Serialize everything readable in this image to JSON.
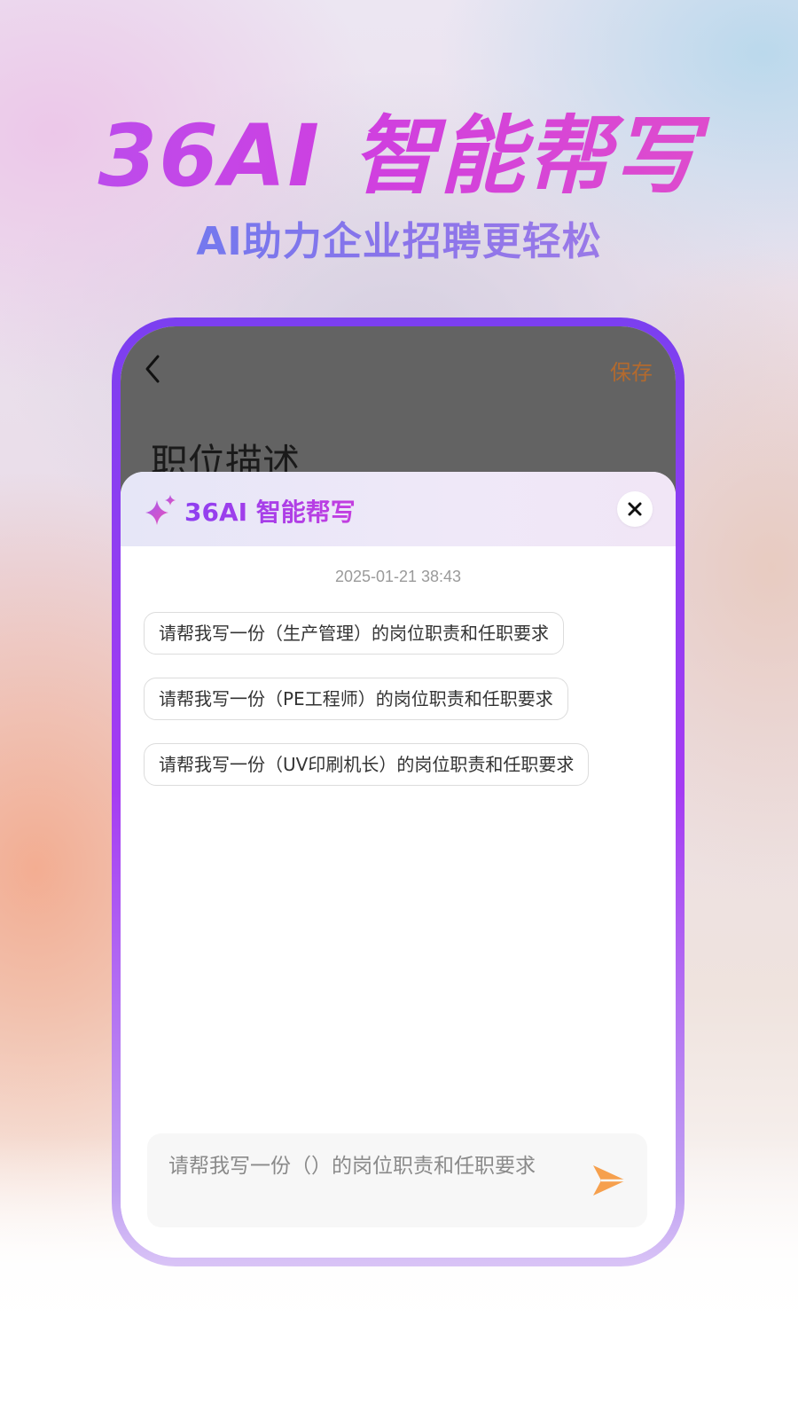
{
  "hero": {
    "title": "36AI 智能帮写",
    "subtitle": "AI助力企业招聘更轻松"
  },
  "phone_screen": {
    "header": {
      "back_icon": "chevron-left-icon",
      "save_label": "保存",
      "page_heading": "职位描述"
    },
    "sheet": {
      "icon": "sparkle-icon",
      "title": "36AI 智能帮写",
      "close_icon": "close-icon",
      "timestamp": "2025-01-21 38:43",
      "suggestions": [
        "请帮我写一份（生产管理）的岗位职责和任职要求",
        "请帮我写一份（PE工程师）的岗位职责和任职要求",
        "请帮我写一份（UV印刷机长）的岗位职责和任职要求"
      ],
      "input": {
        "value": "请帮我写一份（）的岗位职责和任职要求",
        "send_icon": "send-icon"
      }
    }
  },
  "colors": {
    "accent_purple": "#a53cf2",
    "title_pink": "#cf3fe0",
    "subtitle_blue": "#5f7cf2",
    "save_orange": "#b36a2e",
    "send_orange": "#f6a04d"
  }
}
